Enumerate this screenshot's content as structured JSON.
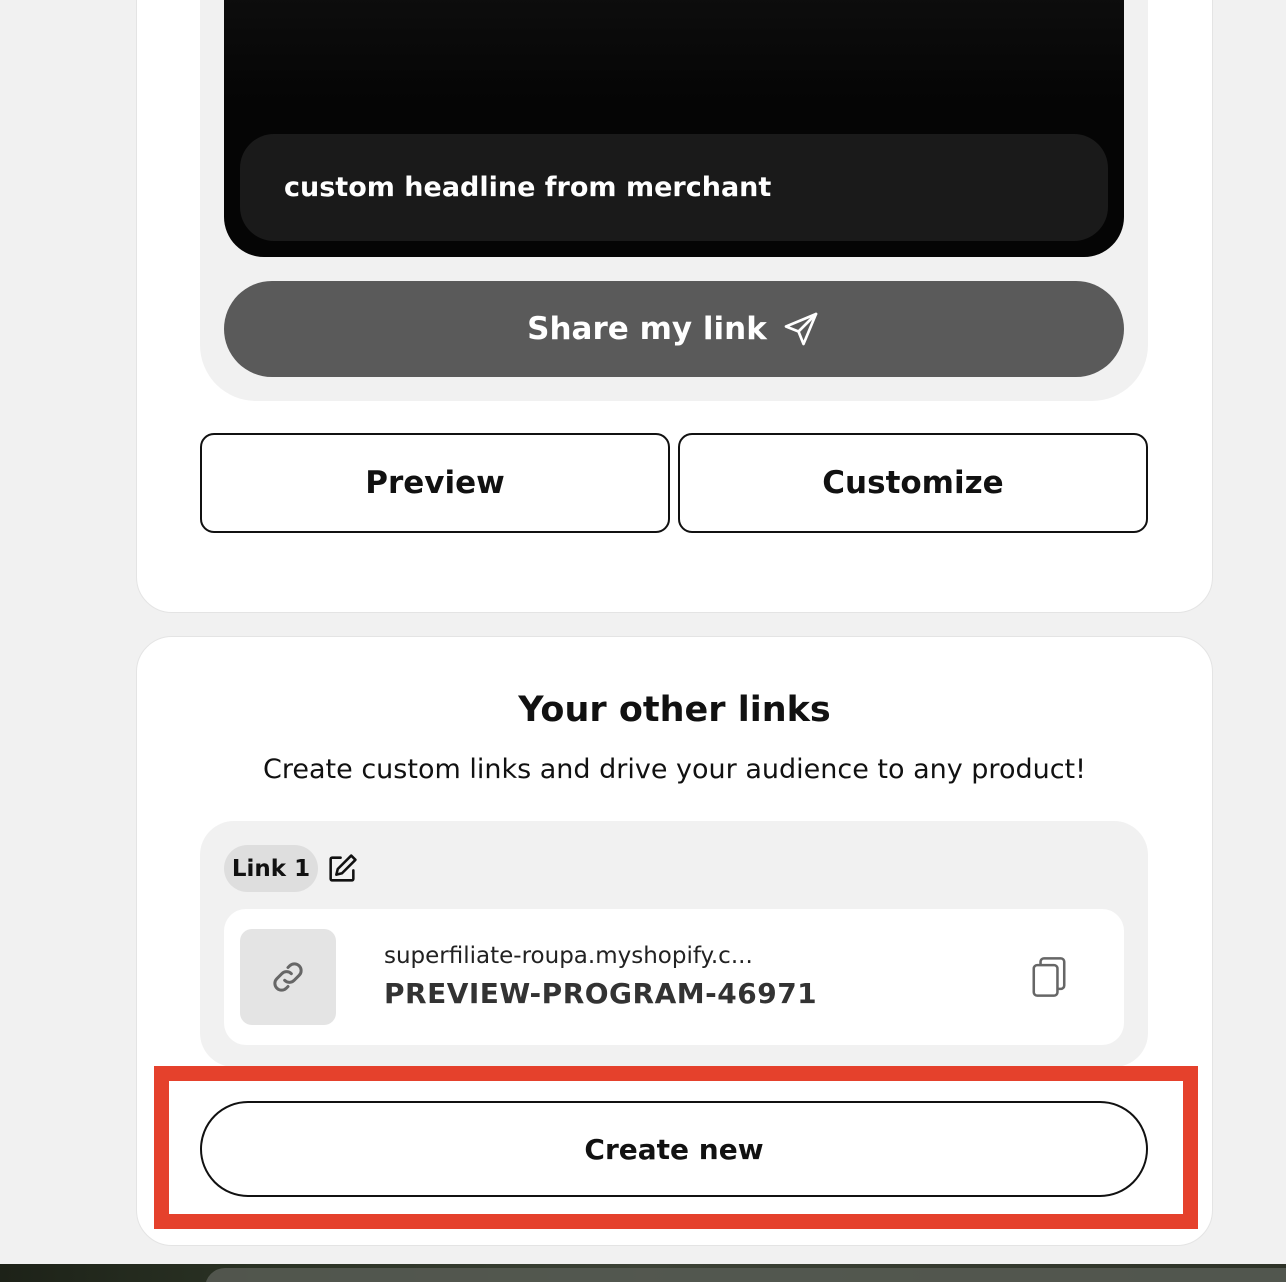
{
  "preview_card": {
    "headline": "custom headline from merchant",
    "share_label": "Share my link",
    "preview_label": "Preview",
    "customize_label": "Customize"
  },
  "other_links": {
    "title": "Your other links",
    "subtitle": "Create custom links and drive your audience to any product!",
    "links": [
      {
        "chip": "Link 1",
        "url": "superfiliate-roupa.myshopify.c...",
        "code": "PREVIEW-PROGRAM-46971"
      }
    ],
    "create_label": "Create new"
  },
  "colors": {
    "highlight": "#e5412c",
    "share_button": "#5a5a5a",
    "page_bg": "#f1f1f1"
  },
  "icons": {
    "share": "paper-plane-icon",
    "edit": "pencil-square-icon",
    "link": "link-chain-icon",
    "copy": "copy-icon"
  }
}
